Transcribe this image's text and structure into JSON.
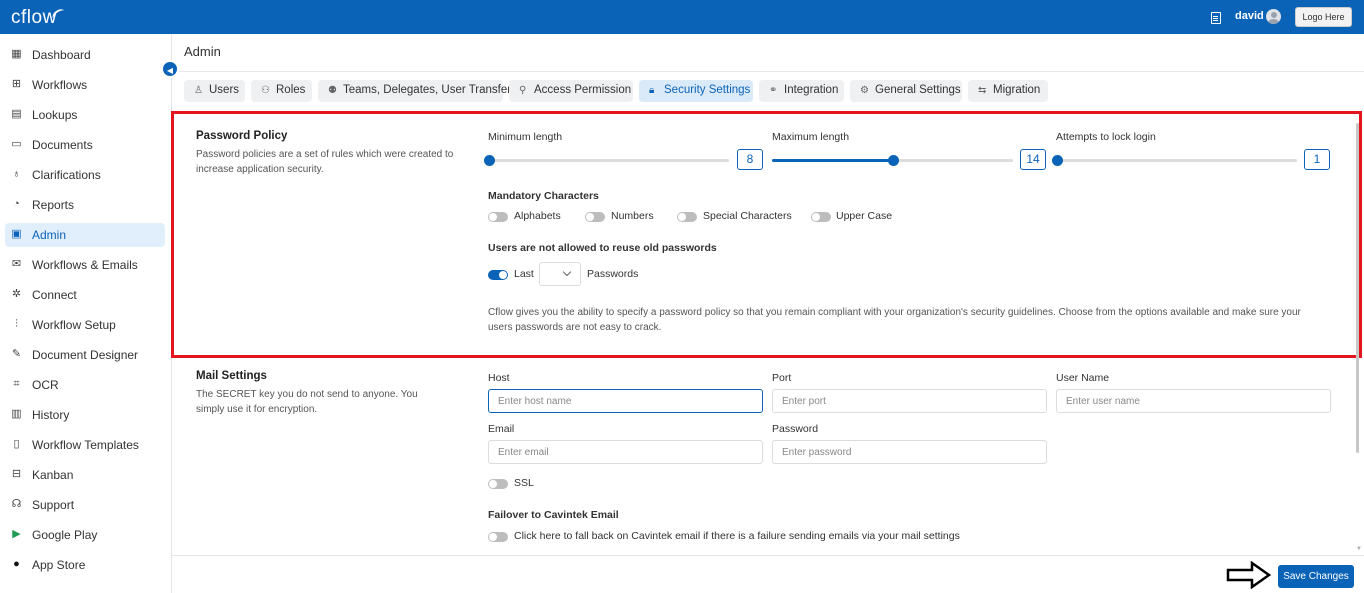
{
  "topbar": {
    "logo": "cflow",
    "username": "david",
    "logo_button": "Logo Here"
  },
  "sidebar": {
    "items": [
      {
        "label": "Dashboard",
        "icon": "dashboard-icon"
      },
      {
        "label": "Workflows",
        "icon": "workflows-icon"
      },
      {
        "label": "Lookups",
        "icon": "lookups-icon"
      },
      {
        "label": "Documents",
        "icon": "documents-icon"
      },
      {
        "label": "Clarifications",
        "icon": "clarifications-icon"
      },
      {
        "label": "Reports",
        "icon": "reports-icon"
      },
      {
        "label": "Admin",
        "icon": "admin-icon",
        "active": true
      },
      {
        "label": "Workflows & Emails",
        "icon": "mail-icon"
      },
      {
        "label": "Connect",
        "icon": "connect-icon"
      },
      {
        "label": "Workflow Setup",
        "icon": "sliders-icon"
      },
      {
        "label": "Document Designer",
        "icon": "designer-icon"
      },
      {
        "label": "OCR",
        "icon": "ocr-icon"
      },
      {
        "label": "History",
        "icon": "history-icon"
      },
      {
        "label": "Workflow Templates",
        "icon": "templates-icon"
      },
      {
        "label": "Kanban",
        "icon": "kanban-icon"
      },
      {
        "label": "Support",
        "icon": "support-icon"
      },
      {
        "label": "Google Play",
        "icon": "google-play-icon"
      },
      {
        "label": "App Store",
        "icon": "apple-icon"
      }
    ]
  },
  "page": {
    "title": "Admin",
    "tabs": [
      {
        "label": "Users",
        "icon": "user-icon"
      },
      {
        "label": "Roles",
        "icon": "roles-icon"
      },
      {
        "label": "Teams, Delegates, User Transfer",
        "icon": "teams-icon"
      },
      {
        "label": "Access Permission",
        "icon": "permission-icon"
      },
      {
        "label": "Security Settings",
        "icon": "lock-icon",
        "active": true
      },
      {
        "label": "Integration",
        "icon": "integration-icon"
      },
      {
        "label": "General Settings",
        "icon": "settings-icon"
      },
      {
        "label": "Migration",
        "icon": "migration-icon"
      }
    ]
  },
  "password_policy": {
    "title": "Password Policy",
    "description": "Password policies are a set of rules which were created to increase application security.",
    "min_length": {
      "label": "Minimum length",
      "value": "8",
      "fraction": 0.0
    },
    "max_length": {
      "label": "Maximum length",
      "value": "14",
      "fraction": 0.5
    },
    "attempts": {
      "label": "Attempts to lock login",
      "value": "1",
      "fraction": 0.0
    },
    "mandatory_label": "Mandatory Characters",
    "mandatory": [
      {
        "label": "Alphabets",
        "on": false
      },
      {
        "label": "Numbers",
        "on": false
      },
      {
        "label": "Special Characters",
        "on": false
      },
      {
        "label": "Upper Case",
        "on": false
      }
    ],
    "reuse_label": "Users are not allowed to reuse old passwords",
    "reuse_last_label": "Last",
    "reuse_last_on": true,
    "reuse_passwords_label": "Passwords",
    "note": "Cflow gives you the ability to specify a password policy so that you remain compliant with your organization's security guidelines. Choose from the options available and make sure your users passwords are not easy to crack."
  },
  "mail_settings": {
    "title": "Mail Settings",
    "description": "The SECRET key you do not send to anyone. You simply use it for encryption.",
    "host": {
      "label": "Host",
      "placeholder": "Enter host name"
    },
    "port": {
      "label": "Port",
      "placeholder": "Enter port"
    },
    "user_name": {
      "label": "User Name",
      "placeholder": "Enter user name"
    },
    "email": {
      "label": "Email",
      "placeholder": "Enter email"
    },
    "password": {
      "label": "Password",
      "placeholder": "Enter password"
    },
    "ssl_label": "SSL",
    "failover_title": "Failover to Cavintek Email",
    "failover_label": "Click here to fall back on Cavintek email if there is a failure sending emails via your mail settings"
  },
  "footer": {
    "save_label": "Save Changes"
  }
}
